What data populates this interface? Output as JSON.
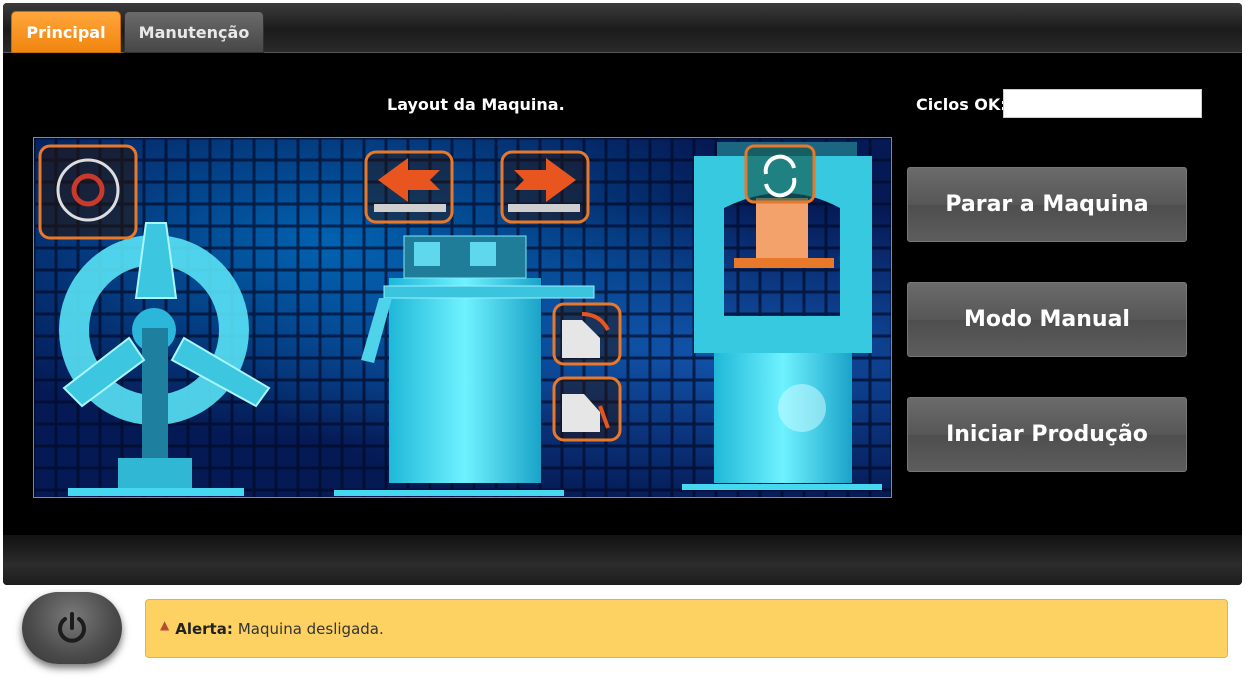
{
  "tabs": [
    {
      "label": "Principal",
      "active": true
    },
    {
      "label": "Manutenção",
      "active": false
    }
  ],
  "main": {
    "layout_title": "Layout da Maquina.",
    "ciclos_label": "Ciclos OK:",
    "ciclos_value": ""
  },
  "actions": {
    "stop_label": "Parar a Maquina",
    "manual_label": "Modo Manual",
    "start_label": "Iniciar Produção"
  },
  "power": {
    "icon": "power-icon"
  },
  "alert": {
    "icon": "warning-icon",
    "label": "Alerta:",
    "message": "Maquina desligada."
  },
  "colors": {
    "accent": "#f0850f",
    "alert_bg": "#fdd262",
    "machine_cyan": "#3ee0f5",
    "control_orange": "#e8782a"
  }
}
